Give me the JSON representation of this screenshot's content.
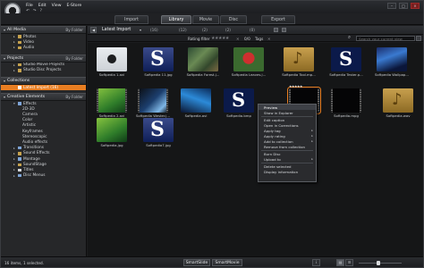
{
  "menu": {
    "file": "File",
    "edit": "Edit",
    "view": "View",
    "estore": "E-Store"
  },
  "window_controls": {
    "minimize": "–",
    "maximize": "□",
    "close": "×"
  },
  "tabs": {
    "import": "Import",
    "library": "Library",
    "movie": "Movie",
    "disc": "Disc",
    "export": "Export",
    "active": "Library"
  },
  "sidebar": {
    "all_media": {
      "label": "All Media",
      "sort": "By Folder"
    },
    "all_media_items": [
      "Photos",
      "Video",
      "Audio"
    ],
    "projects": {
      "label": "Projects",
      "sort": "By Folder"
    },
    "project_items": [
      "Studio Movie Projects",
      "Studio Disc Projects"
    ],
    "collections": {
      "label": "Collections"
    },
    "collection_items": [
      "Latest Import (16)"
    ],
    "creative": {
      "label": "Creative Elements",
      "sort": "By Folder"
    },
    "creative_items": [
      "Effects",
      "2D-3D",
      "Camera",
      "Color",
      "Artistic",
      "Keyframes",
      "Stereoscopic",
      "Audio effects",
      "Transitions",
      "Sound Effects",
      "Montage",
      "SoundStage",
      "Titles",
      "Disc Menus"
    ]
  },
  "toolbar": {
    "back": "◀",
    "collection_title": "Latest Import",
    "filters": [
      "(16)",
      "(12)",
      "(2)",
      "(2)",
      "(0)"
    ]
  },
  "rating": {
    "label": "Rating filter",
    "stars": "★★★★★",
    "clear": "✕",
    "count": "0/0",
    "tags_label": "Tags",
    "tags_clear": "✕"
  },
  "search": {
    "placeholder": "Search your current view"
  },
  "thumbnails": [
    {
      "caption": "Softpedia 1.avi",
      "kind": "white"
    },
    {
      "caption": "Softpedia 11.jpg",
      "kind": "sicon"
    },
    {
      "caption": "Softpedia Forest.j...",
      "kind": "forest"
    },
    {
      "caption": "Softpedia Leaves.j...",
      "kind": "flower"
    },
    {
      "caption": "Softpedia Tool.mp...",
      "kind": "music"
    },
    {
      "caption": "Softpedia Tester.p...",
      "kind": "snav"
    },
    {
      "caption": "Softpedia Wallpap...",
      "kind": "wall1"
    },
    {
      "caption": "Softpedia 2.avi",
      "kind": "green"
    },
    {
      "caption": "Softpedia Wester.j...",
      "kind": "vid"
    },
    {
      "caption": "Softpedia.avi",
      "kind": "wall2"
    },
    {
      "caption": "Softpedia.bmp",
      "kind": "snav"
    },
    {
      "caption": "Softpedia.jpg",
      "kind": "wall3",
      "selected": true,
      "stars": "★★★★★"
    },
    {
      "caption": "Softpedia.mp4",
      "kind": "dark"
    },
    {
      "caption": "Softpedia.mpg",
      "kind": "dark"
    },
    {
      "caption": "Softpedia.wav",
      "kind": "music"
    },
    {
      "caption": "Softpedia.jpg",
      "kind": "green"
    },
    {
      "caption": "Softpedia7.jpg",
      "kind": "sicon"
    }
  ],
  "context_menu": {
    "items": [
      "Preview",
      "Show in Explorer",
      "Edit caption",
      "Open in Corrections",
      "Apply tag",
      "Apply rating",
      "Add to collection",
      "Remove from collection",
      "Burn Disc",
      "Upload to",
      "Delete selected",
      "Display information"
    ],
    "submenu_marker": "▸"
  },
  "statusbar": {
    "text": "16 items, 1 selected.",
    "smartslide": "SmartSlide",
    "smartmovie": "SmartMovie"
  }
}
